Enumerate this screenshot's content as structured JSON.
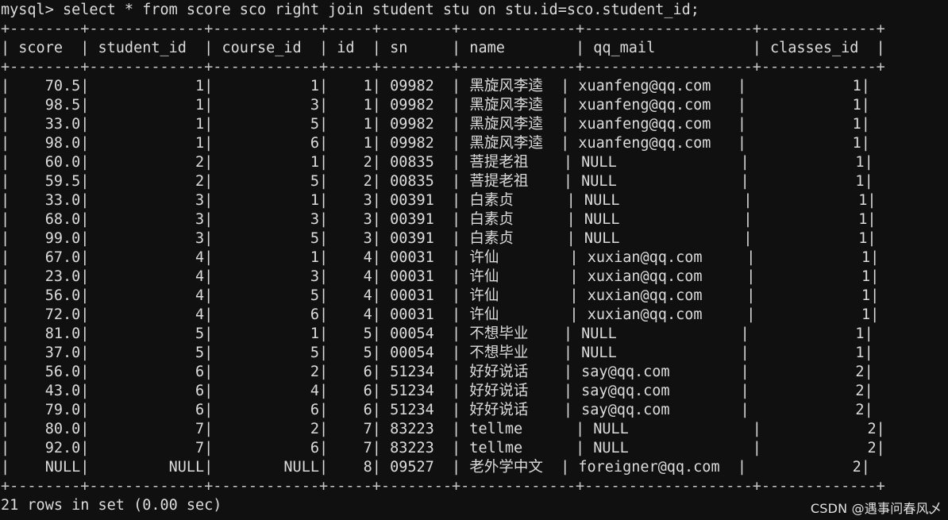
{
  "terminal": {
    "prompt": "mysql> ",
    "query": "select * from score sco right join student stu on stu.id=sco.student_id;",
    "prompt_line": "mysql> select * from score sco right join student stu on stu.id=sco.student_id;",
    "status": "21 rows in set (0.00 sec)",
    "row_count": 21,
    "elapsed": "0.00 sec",
    "background_color": "#101010",
    "text_color": "#dcdcdc",
    "border_color": "#c9c9c9"
  },
  "watermark": {
    "text": "CSDN @遇事问春风乄"
  },
  "table": {
    "columns": [
      {
        "name": "score",
        "width": 7,
        "align": "right"
      },
      {
        "name": "student_id",
        "width": 12,
        "align": "right"
      },
      {
        "name": "course_id",
        "width": 11,
        "align": "right"
      },
      {
        "name": "id",
        "width": 4,
        "align": "right"
      },
      {
        "name": "sn",
        "width": 7,
        "align": "left"
      },
      {
        "name": "name",
        "width": 12,
        "align": "left"
      },
      {
        "name": "qq_mail",
        "width": 18,
        "align": "left"
      },
      {
        "name": "classes_id",
        "width": 12,
        "align": "right"
      }
    ],
    "headers": [
      "score",
      "student_id",
      "course_id",
      "id",
      "sn",
      "name",
      "qq_mail",
      "classes_id"
    ],
    "rows": [
      [
        "70.5",
        "1",
        "1",
        "1",
        "09982",
        "黑旋风李逵",
        "xuanfeng@qq.com",
        "1"
      ],
      [
        "98.5",
        "1",
        "3",
        "1",
        "09982",
        "黑旋风李逵",
        "xuanfeng@qq.com",
        "1"
      ],
      [
        "33.0",
        "1",
        "5",
        "1",
        "09982",
        "黑旋风李逵",
        "xuanfeng@qq.com",
        "1"
      ],
      [
        "98.0",
        "1",
        "6",
        "1",
        "09982",
        "黑旋风李逵",
        "xuanfeng@qq.com",
        "1"
      ],
      [
        "60.0",
        "2",
        "1",
        "2",
        "00835",
        "菩提老祖",
        "NULL",
        "1"
      ],
      [
        "59.5",
        "2",
        "5",
        "2",
        "00835",
        "菩提老祖",
        "NULL",
        "1"
      ],
      [
        "33.0",
        "3",
        "1",
        "3",
        "00391",
        "白素贞",
        "NULL",
        "1"
      ],
      [
        "68.0",
        "3",
        "3",
        "3",
        "00391",
        "白素贞",
        "NULL",
        "1"
      ],
      [
        "99.0",
        "3",
        "5",
        "3",
        "00391",
        "白素贞",
        "NULL",
        "1"
      ],
      [
        "67.0",
        "4",
        "1",
        "4",
        "00031",
        "许仙",
        "xuxian@qq.com",
        "1"
      ],
      [
        "23.0",
        "4",
        "3",
        "4",
        "00031",
        "许仙",
        "xuxian@qq.com",
        "1"
      ],
      [
        "56.0",
        "4",
        "5",
        "4",
        "00031",
        "许仙",
        "xuxian@qq.com",
        "1"
      ],
      [
        "72.0",
        "4",
        "6",
        "4",
        "00031",
        "许仙",
        "xuxian@qq.com",
        "1"
      ],
      [
        "81.0",
        "5",
        "1",
        "5",
        "00054",
        "不想毕业",
        "NULL",
        "1"
      ],
      [
        "37.0",
        "5",
        "5",
        "5",
        "00054",
        "不想毕业",
        "NULL",
        "1"
      ],
      [
        "56.0",
        "6",
        "2",
        "6",
        "51234",
        "好好说话",
        "say@qq.com",
        "2"
      ],
      [
        "43.0",
        "6",
        "4",
        "6",
        "51234",
        "好好说话",
        "say@qq.com",
        "2"
      ],
      [
        "79.0",
        "6",
        "6",
        "6",
        "51234",
        "好好说话",
        "say@qq.com",
        "2"
      ],
      [
        "80.0",
        "7",
        "2",
        "7",
        "83223",
        "tellme",
        "NULL",
        "2"
      ],
      [
        "92.0",
        "7",
        "6",
        "7",
        "83223",
        "tellme",
        "NULL",
        "2"
      ],
      [
        "NULL",
        "NULL",
        "NULL",
        "8",
        "09527",
        "老外学中文",
        "foreigner@qq.com",
        "2"
      ]
    ]
  }
}
